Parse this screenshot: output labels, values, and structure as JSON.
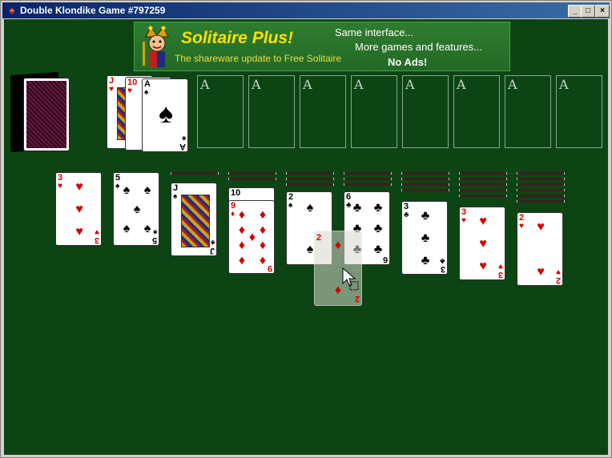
{
  "window": {
    "title": "Double Klondike   Game #797259",
    "minimize_label": "_",
    "maximize_label": "□",
    "close_label": "×"
  },
  "banner": {
    "title": "Solitaire Plus!",
    "subtitle": "The shareware update to Free Solitaire",
    "line1": "Same interface...",
    "line2": "More games and features...",
    "line3": "No Ads!"
  },
  "foundation_label": "A",
  "colors": {
    "felt": "#0c4513",
    "red_suit": "#d40000",
    "black_suit": "#000000"
  },
  "waste": {
    "fanned": [
      {
        "rank": "J",
        "suit": "♥"
      },
      {
        "rank": "10",
        "suit": "♥"
      },
      {
        "rank": "A",
        "suit": "♠"
      }
    ],
    "top": {
      "rank": "A",
      "suit": "♠"
    }
  },
  "tableau": [
    {
      "hidden": 0,
      "top": {
        "rank": "3",
        "suit": "♥"
      }
    },
    {
      "hidden": 0,
      "top": {
        "rank": "5",
        "suit": "♠"
      }
    },
    {
      "hidden": 1,
      "top": {
        "rank": "J",
        "suit": "♠"
      }
    },
    {
      "hidden": 2,
      "faceup_under": {
        "rank": "10",
        "suit": "♠"
      },
      "top": {
        "rank": "9",
        "suit": "♦"
      }
    },
    {
      "hidden": 3,
      "top": {
        "rank": "2",
        "suit": "♠"
      }
    },
    {
      "hidden": 3,
      "top": {
        "rank": "6",
        "suit": "♣"
      }
    },
    {
      "hidden": 4,
      "top": {
        "rank": "3",
        "suit": "♣"
      }
    },
    {
      "hidden": 5,
      "top": {
        "rank": "3",
        "suit": "♥"
      }
    },
    {
      "hidden": 6,
      "top": {
        "rank": "2",
        "suit": "♥"
      }
    }
  ],
  "dragging": {
    "rank": "2",
    "suit": "♦"
  }
}
